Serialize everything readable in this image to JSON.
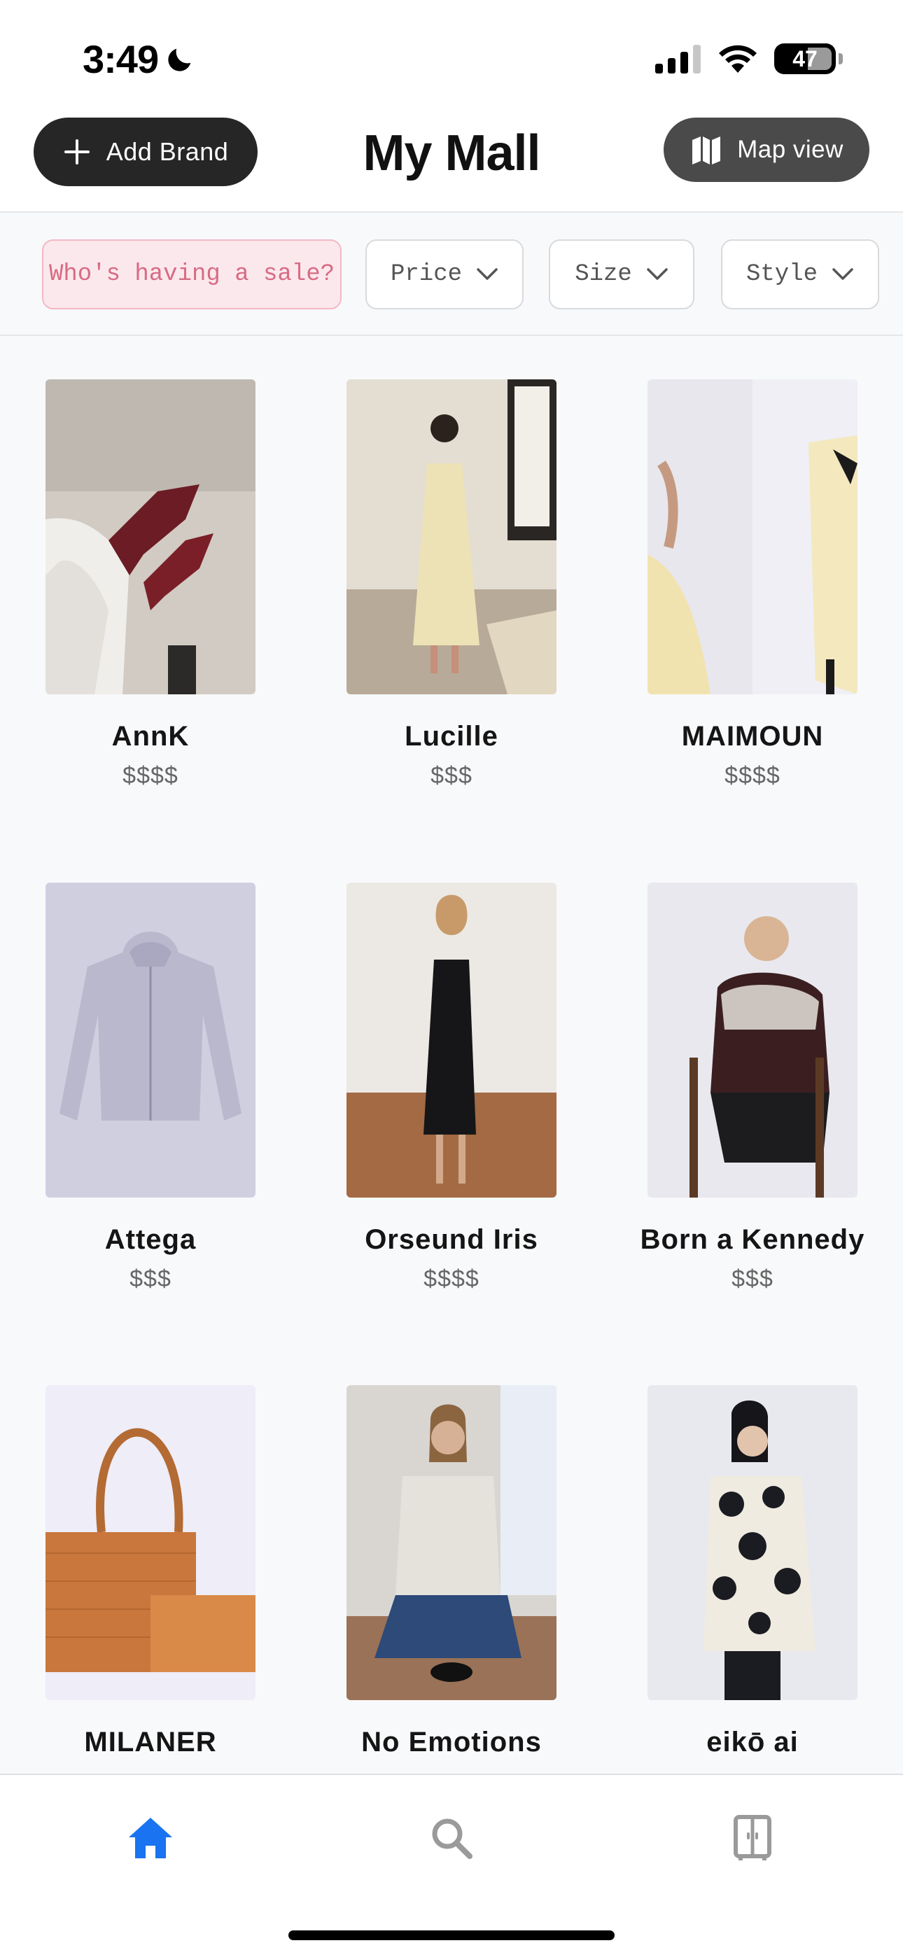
{
  "status_bar": {
    "time": "3:49",
    "battery_level": "47",
    "icons": [
      "moon-icon",
      "cellular-signal-icon",
      "wifi-icon",
      "battery-icon"
    ]
  },
  "header": {
    "add_brand_label": "Add Brand",
    "title": "My Mall",
    "map_view_label": "Map view"
  },
  "filters": [
    {
      "label": "Who's having a sale?",
      "has_chevron": false,
      "highlight": "#fbe8ec"
    },
    {
      "label": "Price",
      "has_chevron": true
    },
    {
      "label": "Size",
      "has_chevron": true
    },
    {
      "label": "Style",
      "has_chevron": true
    }
  ],
  "brands": [
    {
      "name": "AnnK",
      "price": "$$$$",
      "image": "legs-in-burgundy-boots-photo"
    },
    {
      "name": "Lucille",
      "price": "$$$",
      "image": "woman-in-cream-slip-dress-photo"
    },
    {
      "name": "MAIMOUN",
      "price": "$$$$",
      "image": "yellow-dress-with-black-bow-photo"
    },
    {
      "name": "Attega",
      "price": "$$$",
      "image": "lilac-zip-hoodie-photo"
    },
    {
      "name": "Orseund Iris",
      "price": "$$$$",
      "image": "woman-in-black-midi-dress-photo"
    },
    {
      "name": "Born a Kennedy",
      "price": "$$$",
      "image": "woman-in-fair-isle-sweater-photo"
    },
    {
      "name": "MILANER",
      "price": "",
      "image": "woven-leather-tote-photo"
    },
    {
      "name": "No Emotions",
      "price": "",
      "image": "woman-in-cream-vest-photo"
    },
    {
      "name": "eikō ai",
      "price": "",
      "image": "woman-in-floral-jacket-photo"
    }
  ],
  "tab_bar": {
    "tabs": [
      {
        "name": "Home",
        "icon": "home-icon",
        "active": true
      },
      {
        "name": "Search",
        "icon": "search-icon",
        "active": false
      },
      {
        "name": "Wardrobe",
        "icon": "wardrobe-icon",
        "active": false
      }
    ],
    "active_color": "#1a73f0",
    "inactive_color": "#9a9a9a"
  },
  "colors": {
    "button_dark": "#262626",
    "map_button": "#4a4a4a",
    "sale_chip_text": "#d86b84",
    "background": "#f8f9fb"
  }
}
